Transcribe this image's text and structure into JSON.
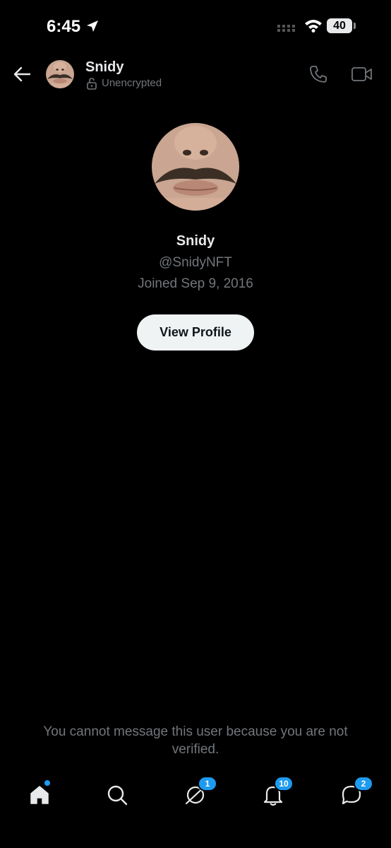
{
  "status_bar": {
    "time": "6:45",
    "battery": "40",
    "icons": [
      "location-arrow-icon",
      "signal-icon",
      "wifi-icon",
      "battery-icon"
    ]
  },
  "header": {
    "name": "Snidy",
    "encryption": "Unencrypted",
    "icons": [
      "back-arrow-icon",
      "lock-open-icon",
      "phone-icon",
      "video-icon"
    ]
  },
  "profile": {
    "name": "Snidy",
    "handle": "@SnidyNFT",
    "joined": "Joined Sep 9, 2016",
    "view_profile_label": "View Profile"
  },
  "notice": "You cannot message this user because you are not verified.",
  "tab_bar": {
    "tabs": [
      {
        "icon": "home-icon",
        "indicator": "dot"
      },
      {
        "icon": "search-icon"
      },
      {
        "icon": "spaces-icon",
        "badge": "1"
      },
      {
        "icon": "bell-icon",
        "badge": "10"
      },
      {
        "icon": "messages-icon",
        "badge": "2"
      }
    ]
  },
  "colors": {
    "background": "#000000",
    "text_primary": "#e7e9ea",
    "text_secondary": "#71767b",
    "accent": "#1d9bf0",
    "button_bg": "#eff3f4"
  }
}
